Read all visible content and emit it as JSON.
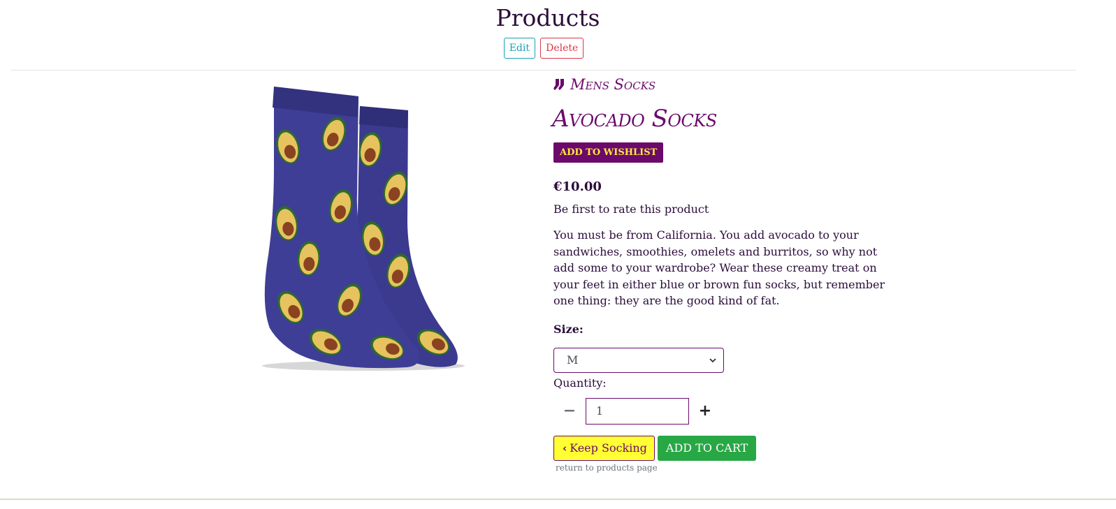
{
  "header": {
    "title": "Products"
  },
  "admin": {
    "edit_label": "Edit",
    "delete_label": "Delete"
  },
  "product": {
    "category": "Mens Socks",
    "name": "Avocado Socks",
    "wishlist_label": "ADD TO WISHLIST",
    "price": "€10.00",
    "rating_text": "Be first to rate this product",
    "description": "You must be from California. You add avocado to your sandwiches, smoothies, omelets and burritos, so why not add some to your wardrobe? Wear these creamy treat on your feet in either blue or brown fun socks, but remember one thing: they are the good kind of fat."
  },
  "form": {
    "size_label": "Size:",
    "size_value": "M",
    "quantity_label": "Quantity:",
    "quantity_value": "1",
    "keep_label": "Keep Socking",
    "cart_label": "ADD TO CART",
    "helper_text": "return to products page"
  },
  "colors": {
    "brand_purple": "#6b0a6b",
    "accent_yellow": "#ffff33",
    "cart_green": "#28a745",
    "sock_navy": "#3b3a8f"
  },
  "icons": {
    "category": "socks-icon",
    "size_dropdown": "chevron-down-icon",
    "quantity_decrement": "minus-icon",
    "quantity_increment": "plus-icon",
    "keep_button": "chevron-left-icon"
  }
}
